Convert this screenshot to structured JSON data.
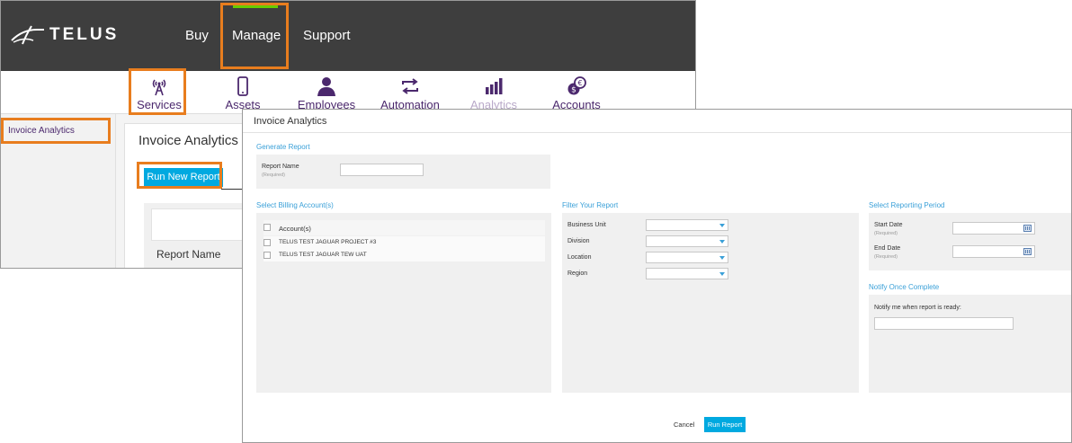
{
  "header": {
    "logo_text": "TELUS",
    "nav": [
      "Buy",
      "Manage",
      "Support"
    ]
  },
  "subnav": {
    "items": [
      {
        "label": "Services",
        "icon": "antenna-icon"
      },
      {
        "label": "Assets",
        "icon": "phone-icon"
      },
      {
        "label": "Employees",
        "icon": "person-icon"
      },
      {
        "label": "Automation",
        "icon": "arrows-icon"
      },
      {
        "label": "Analytics",
        "icon": "bar-chart-icon"
      },
      {
        "label": "Accounts",
        "icon": "coins-icon"
      }
    ]
  },
  "sidebar": {
    "item": "Invoice Analytics"
  },
  "page": {
    "title": "Invoice Analytics",
    "run_new_report": "Run New Report",
    "table_column": "Report Name"
  },
  "modal": {
    "title": "Invoice Analytics",
    "generate": {
      "section": "Generate Report",
      "report_name_label": "Report Name",
      "report_name_required": "(Required)"
    },
    "billing": {
      "section": "Select Billing Account(s)",
      "header": "Account(s)",
      "accounts": [
        "TELUS TEST JAGUAR PROJECT #3",
        "TELUS TEST JAGUAR TEW UAT"
      ]
    },
    "filter": {
      "section": "Filter Your Report",
      "fields": [
        "Business Unit",
        "Division",
        "Location",
        "Region"
      ]
    },
    "period": {
      "section": "Select Reporting Period",
      "start_label": "Start Date",
      "end_label": "End Date",
      "required": "(Required)"
    },
    "notify": {
      "section": "Notify Once Complete",
      "label": "Notify me when report is ready:"
    },
    "cancel": "Cancel",
    "run_report": "Run Report"
  },
  "colors": {
    "brand_purple": "#4b286d",
    "accent_blue": "#00a9e0",
    "highlight_orange": "#e87d1e",
    "active_green": "#66cc00"
  }
}
